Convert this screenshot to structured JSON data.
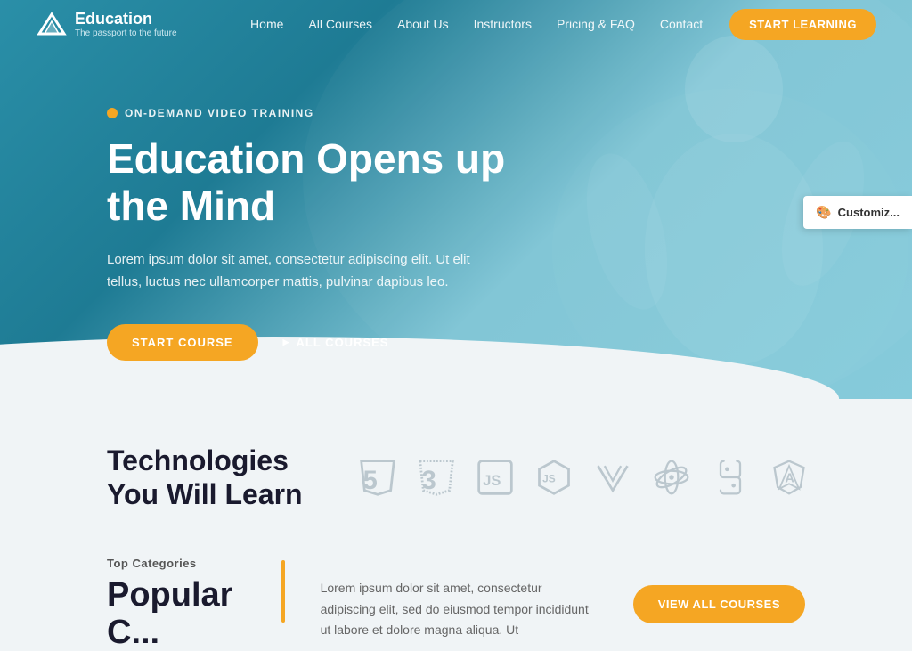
{
  "navbar": {
    "logo_title": "Education",
    "logo_subtitle": "The passport to the future",
    "links": [
      {
        "label": "Home",
        "id": "home"
      },
      {
        "label": "All Courses",
        "id": "all-courses"
      },
      {
        "label": "About Us",
        "id": "about-us"
      },
      {
        "label": "Instructors",
        "id": "instructors"
      },
      {
        "label": "Pricing & FAQ",
        "id": "pricing-faq"
      },
      {
        "label": "Contact",
        "id": "contact"
      }
    ],
    "cta_label": "START LEARNING"
  },
  "hero": {
    "badge_text": "ON-DEMAND VIDEO TRAINING",
    "title": "Education Opens up the Mind",
    "description": "Lorem ipsum dolor sit amet, consectetur adipiscing elit. Ut elit tellus, luctus nec ullamcorper mattis, pulvinar dapibus leo.",
    "btn_start_course": "START COURSE",
    "btn_all_courses": "ALL COURSES"
  },
  "customize": {
    "text": "Customiz..."
  },
  "tech_section": {
    "title": "Technologies You Will Learn",
    "icons": [
      {
        "id": "html5",
        "label": "HTML5",
        "symbol": "5"
      },
      {
        "id": "css3",
        "label": "CSS3",
        "symbol": "3"
      },
      {
        "id": "javascript",
        "label": "JavaScript",
        "symbol": "JS"
      },
      {
        "id": "nodejs",
        "label": "Node.js",
        "symbol": "JS"
      },
      {
        "id": "vue",
        "label": "Vue.js",
        "symbol": "V"
      },
      {
        "id": "react",
        "label": "React",
        "symbol": "⚛"
      },
      {
        "id": "python",
        "label": "Python",
        "symbol": "🐍"
      },
      {
        "id": "angular",
        "label": "Angular",
        "symbol": "A"
      }
    ]
  },
  "categories_section": {
    "label": "Top Categories",
    "title": "Popular C...",
    "description": "Lorem ipsum dolor sit amet, consectetur adipiscing elit, sed do eiusmod tempor incididunt ut labore et dolore magna aliqua. Ut",
    "btn_view_all": "VIEW ALL COURSES"
  }
}
